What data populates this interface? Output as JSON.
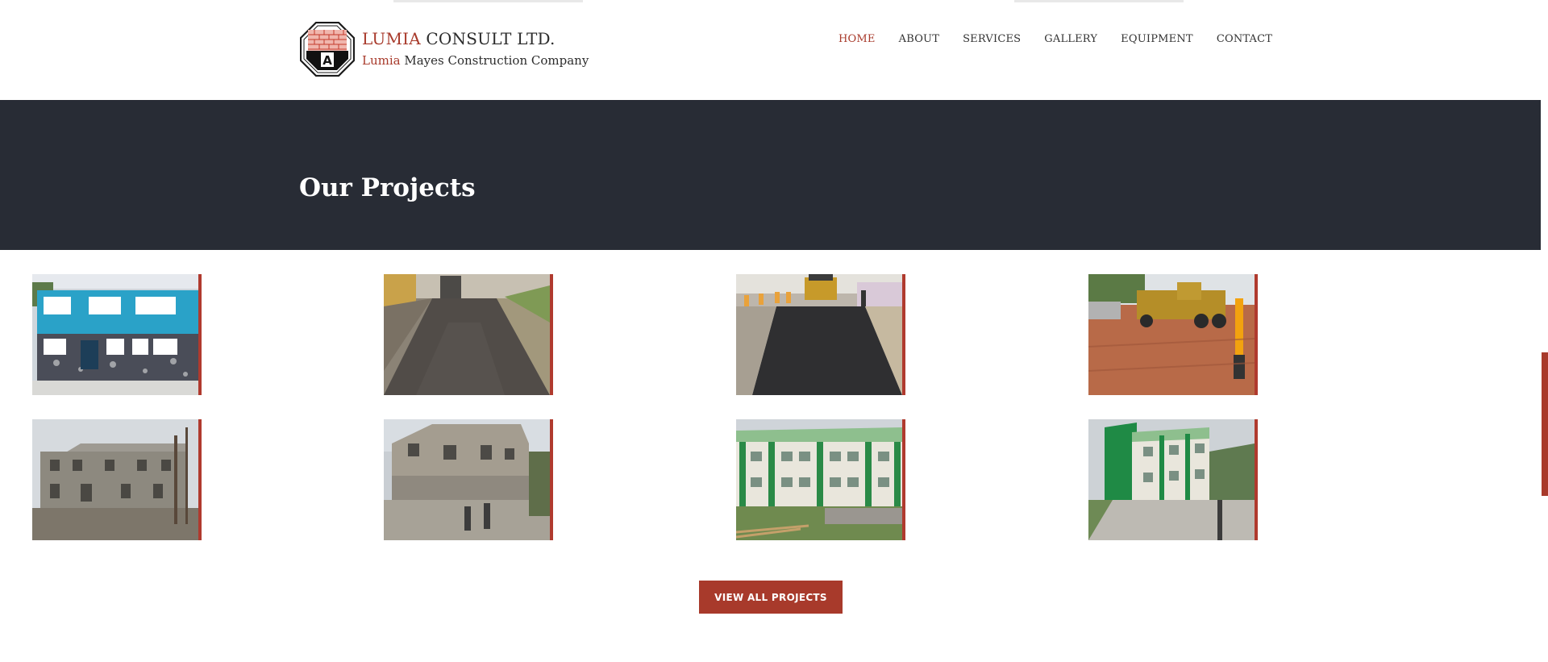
{
  "brand": {
    "title_accent": "LUMIA",
    "title_rest": " CONSULT LTD.",
    "sub_accent": "Lumia",
    "sub_rest": " Mayes Construction Company"
  },
  "nav": {
    "items": [
      {
        "label": "HOME",
        "active": true
      },
      {
        "label": "ABOUT",
        "active": false
      },
      {
        "label": "SERVICES",
        "active": false
      },
      {
        "label": "GALLERY",
        "active": false
      },
      {
        "label": "EQUIPMENT",
        "active": false
      },
      {
        "label": "CONTACT",
        "active": false
      }
    ]
  },
  "banner": {
    "title": "Our Projects"
  },
  "projects": [
    {
      "name": "blue-office-building"
    },
    {
      "name": "wet-asphalt-road"
    },
    {
      "name": "asphalt-paving-crew"
    },
    {
      "name": "grader-on-red-earth"
    },
    {
      "name": "block-building-under-construction"
    },
    {
      "name": "two-storey-block-frame"
    },
    {
      "name": "green-white-hostel-building"
    },
    {
      "name": "green-white-building-with-forecourt"
    }
  ],
  "cta": {
    "label": "VIEW ALL PROJECTS"
  },
  "colors": {
    "accent": "#a83a2b",
    "banner": "#282c35"
  }
}
